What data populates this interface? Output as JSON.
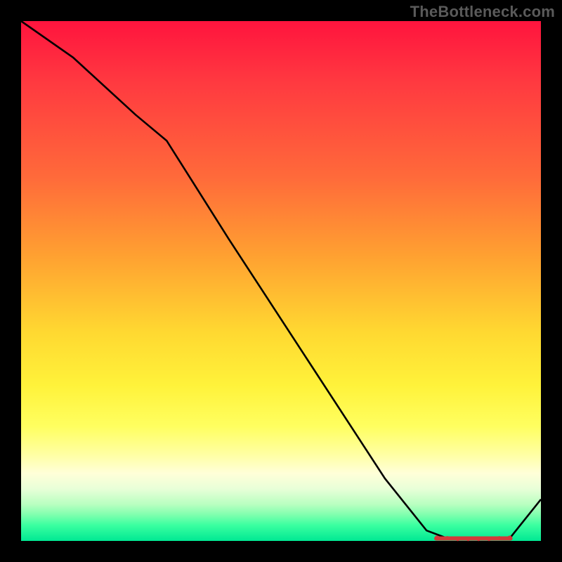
{
  "watermark": "TheBottleneck.com",
  "chart_data": {
    "type": "line",
    "title": "",
    "xlabel": "",
    "ylabel": "",
    "xlim": [
      0,
      100
    ],
    "ylim": [
      0,
      100
    ],
    "grid": false,
    "legend": false,
    "series": [
      {
        "name": "curve",
        "color": "#000000",
        "x": [
          0,
          10,
          22,
          28,
          40,
          55,
          70,
          78,
          82,
          86,
          90,
          94,
          100
        ],
        "values": [
          100,
          93,
          82,
          77,
          58,
          35,
          12,
          2,
          0.5,
          0.3,
          0.3,
          0.5,
          8
        ]
      }
    ],
    "markers": {
      "name": "highlight-region",
      "color": "#d23a3a",
      "x": [
        80,
        82,
        84,
        86,
        88,
        90,
        92,
        94
      ],
      "values": [
        0.6,
        0.5,
        0.4,
        0.4,
        0.4,
        0.4,
        0.5,
        0.6
      ]
    },
    "gradient_stops": [
      {
        "pct": 0,
        "color": "#ff143e"
      },
      {
        "pct": 50,
        "color": "#ffc531"
      },
      {
        "pct": 80,
        "color": "#ffff70"
      },
      {
        "pct": 100,
        "color": "#00e893"
      }
    ]
  }
}
